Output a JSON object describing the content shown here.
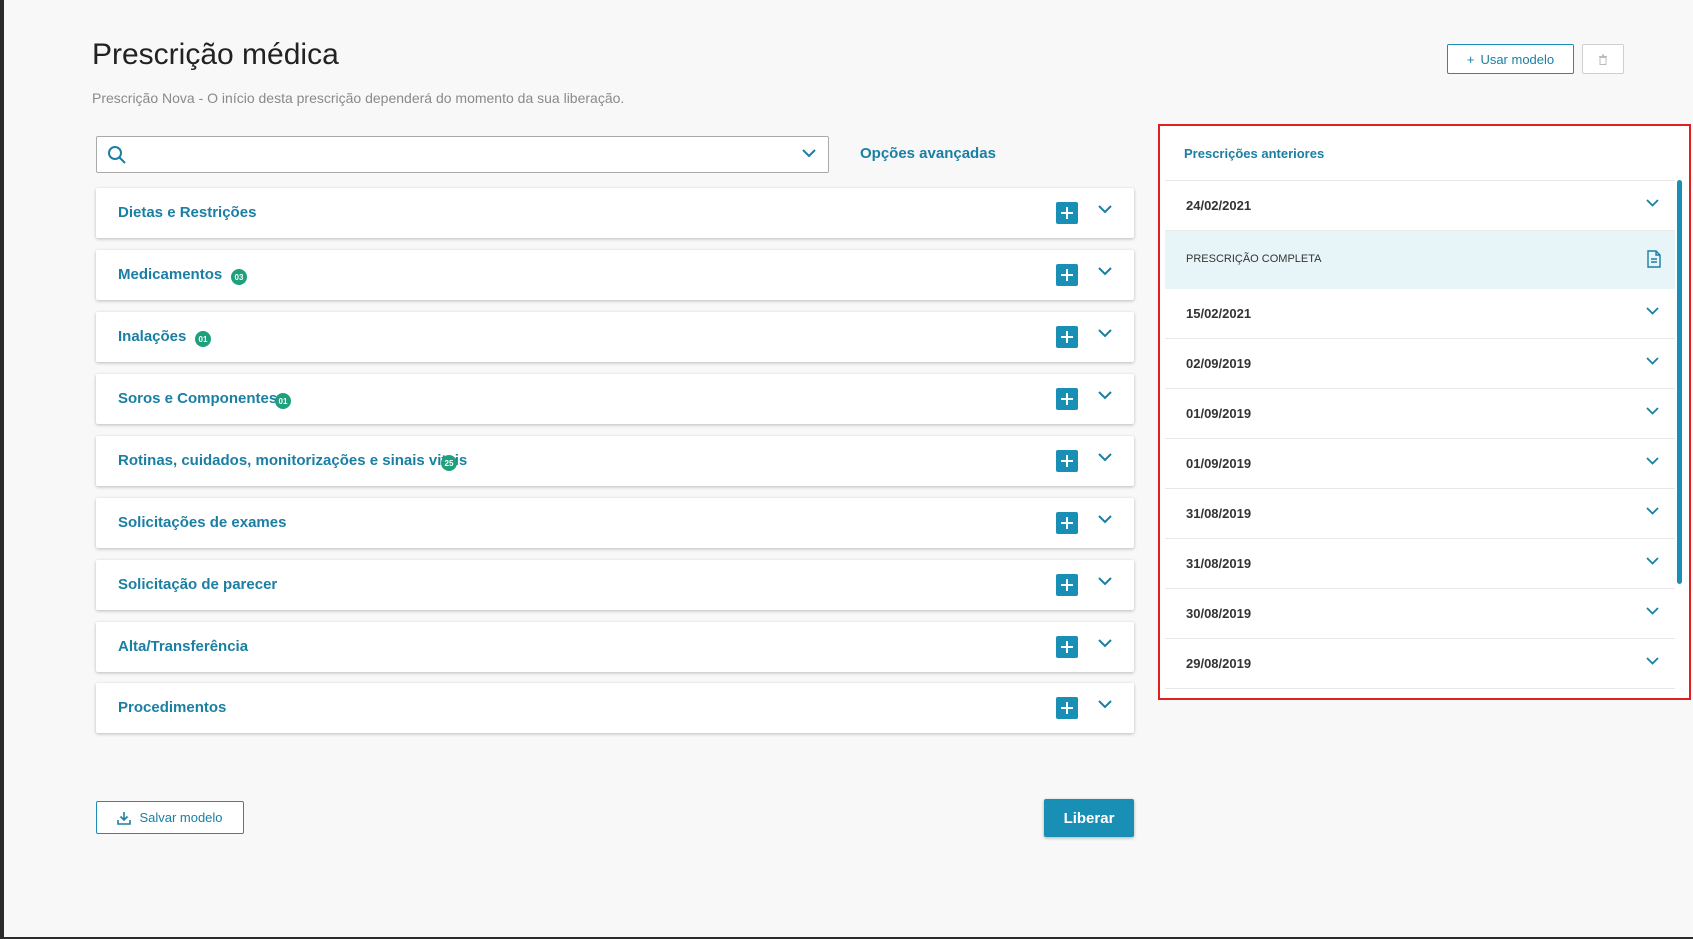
{
  "header": {
    "title": "Prescrição médica",
    "subtitle": "Prescrição Nova - O início desta prescrição dependerá do momento da sua liberação.",
    "use_model_label": "Usar modelo"
  },
  "search": {
    "placeholder": "",
    "advanced_label": "Opções avançadas"
  },
  "sections": [
    {
      "label": "Dietas e Restrições",
      "badge": ""
    },
    {
      "label": "Medicamentos",
      "badge": "03"
    },
    {
      "label": "Inalações",
      "badge": "01"
    },
    {
      "label": "Soros e Componentes",
      "badge": "01"
    },
    {
      "label": "Rotinas, cuidados, monitorizações e sinais vitais",
      "badge": "25"
    },
    {
      "label": "Solicitações de exames",
      "badge": ""
    },
    {
      "label": "Solicitação de parecer",
      "badge": ""
    },
    {
      "label": "Alta/Transferência",
      "badge": ""
    },
    {
      "label": "Procedimentos",
      "badge": ""
    }
  ],
  "footer": {
    "save_model_label": "Salvar modelo",
    "release_label": "Liberar"
  },
  "previous": {
    "title": "Prescrições anteriores",
    "expanded_item_label": "PRESCRIÇÃO COMPLETA",
    "dates": [
      "24/02/2021",
      "15/02/2021",
      "02/09/2019",
      "01/09/2019",
      "01/09/2019",
      "31/08/2019",
      "31/08/2019",
      "30/08/2019",
      "29/08/2019"
    ]
  },
  "colors": {
    "accent": "#1a8fb5",
    "badge": "#1fa07d",
    "highlight_border": "#e02020"
  }
}
